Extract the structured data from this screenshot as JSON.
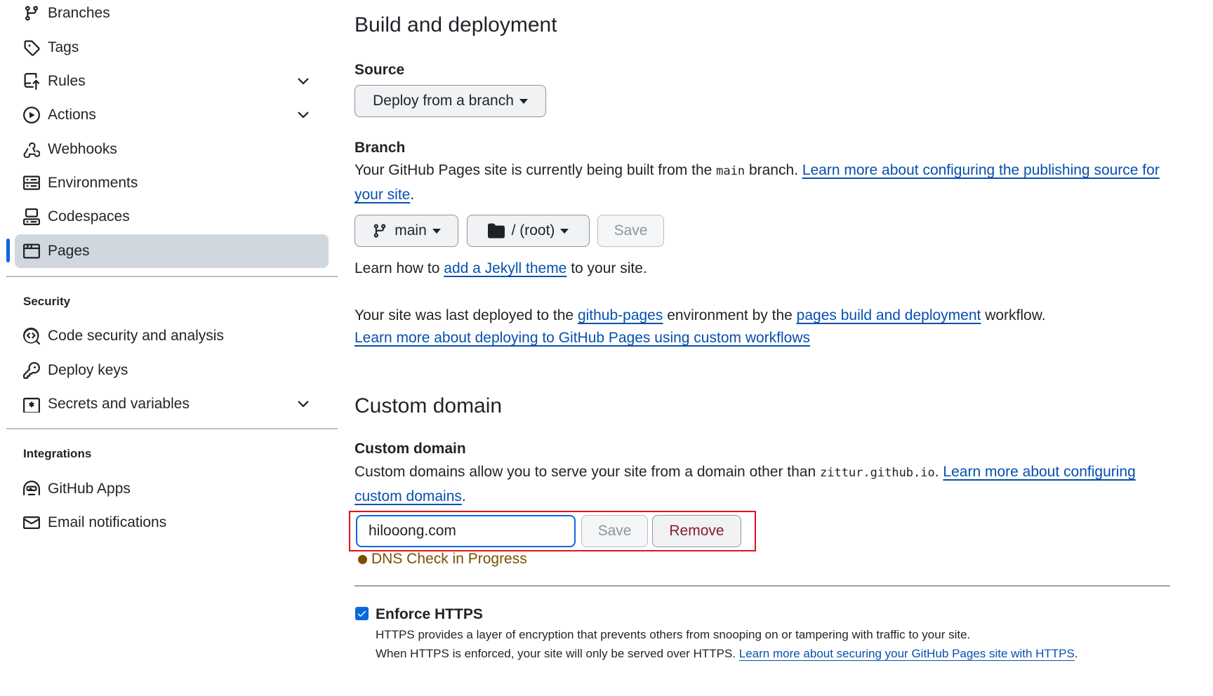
{
  "sidebar": {
    "items": [
      {
        "label": "Branches",
        "icon": "git-branch-icon"
      },
      {
        "label": "Tags",
        "icon": "tag-icon"
      },
      {
        "label": "Rules",
        "icon": "repo-push-icon",
        "expandable": true
      },
      {
        "label": "Actions",
        "icon": "play-icon",
        "expandable": true
      },
      {
        "label": "Webhooks",
        "icon": "webhook-icon"
      },
      {
        "label": "Environments",
        "icon": "server-icon"
      },
      {
        "label": "Codespaces",
        "icon": "codespaces-icon"
      },
      {
        "label": "Pages",
        "icon": "browser-icon",
        "active": true
      }
    ],
    "security_heading": "Security",
    "security_items": [
      {
        "label": "Code security and analysis",
        "icon": "codescan-icon"
      },
      {
        "label": "Deploy keys",
        "icon": "key-icon"
      },
      {
        "label": "Secrets and variables",
        "icon": "key-asterisk-icon",
        "expandable": true
      }
    ],
    "integrations_heading": "Integrations",
    "integrations_items": [
      {
        "label": "GitHub Apps",
        "icon": "hubot-icon"
      },
      {
        "label": "Email notifications",
        "icon": "mail-icon"
      }
    ]
  },
  "build": {
    "title": "Build and deployment",
    "source_label": "Source",
    "source_value": "Deploy from a branch",
    "branch_label": "Branch",
    "branch_text_1": "Your GitHub Pages site is currently being built from the ",
    "branch_code": "main",
    "branch_text_2": " branch. ",
    "branch_link": "Learn more about configuring the publishing source for your site",
    "branch_text_end": ".",
    "branch_select": "main",
    "folder_select": "/ (root)",
    "save_label": "Save",
    "jekyll_pre": "Learn how to ",
    "jekyll_link": "add a Jekyll theme",
    "jekyll_post": " to your site.",
    "deploy_pre": "Your site was last deployed to the ",
    "deploy_env_link": "github-pages",
    "deploy_mid": " environment by the ",
    "deploy_workflow_link": "pages build and deployment",
    "deploy_post": " workflow.",
    "workflows_link": "Learn more about deploying to GitHub Pages using custom workflows"
  },
  "custom_domain": {
    "title": "Custom domain",
    "label": "Custom domain",
    "desc_1": "Custom domains allow you to serve your site from a domain other than ",
    "desc_code": "zittur.github.io",
    "desc_2": ". ",
    "desc_link": "Learn more about configuring custom domains",
    "desc_end": ".",
    "input_value": "hilooong.com",
    "save_label": "Save",
    "remove_label": "Remove",
    "dns_status": "DNS Check in Progress"
  },
  "https": {
    "label": "Enforce HTTPS",
    "checked": true,
    "desc_1": "HTTPS provides a layer of encryption that prevents others from snooping on or tampering with traffic to your site.",
    "desc_2_pre": "When HTTPS is enforced, your site will only be served over HTTPS. ",
    "desc_2_link": "Learn more about securing your GitHub Pages site with HTTPS",
    "desc_2_end": "."
  },
  "colors": {
    "accent": "#0969da",
    "link": "#0550ae",
    "danger": "#8a1c2b",
    "attention": "#7d4e00",
    "highlight_box": "#e5101a"
  }
}
